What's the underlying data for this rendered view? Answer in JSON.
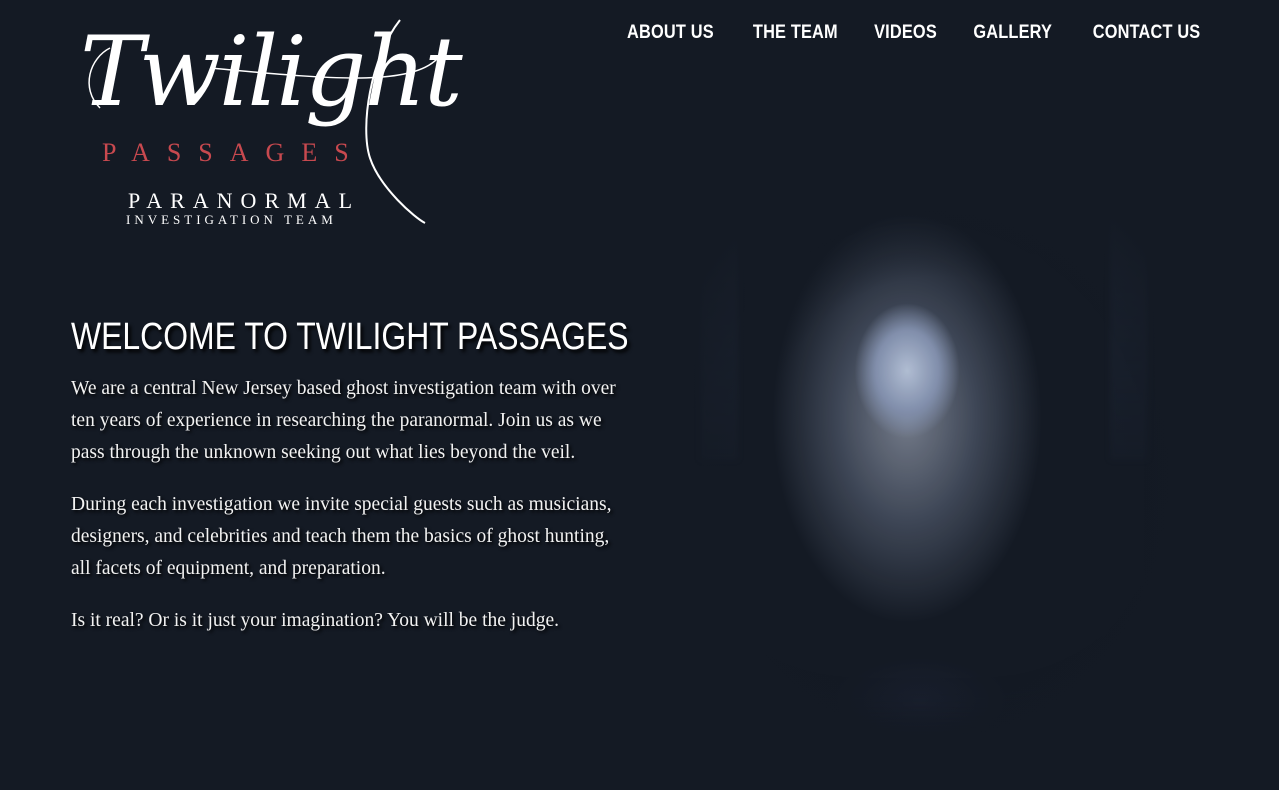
{
  "logo": {
    "title": "Twilight",
    "line2": "PASSAGES",
    "line3": "PARANORMAL",
    "line4": "INVESTIGATION TEAM"
  },
  "nav": {
    "items": [
      {
        "label": "ABOUT US"
      },
      {
        "label": "THE TEAM"
      },
      {
        "label": "VIDEOS"
      },
      {
        "label": "GALLERY"
      },
      {
        "label": "CONTACT US"
      }
    ]
  },
  "main": {
    "heading": "WELCOME TO TWILIGHT PASSAGES",
    "paragraphs": [
      "We are a central New Jersey based ghost investigation team with over ten years of experience in researching the paranormal. Join us as we pass through the unknown seeking out what lies beyond the veil.",
      "During each investigation we invite special guests such as musicians, designers, and celebrities and teach them the basics of ghost hunting, all facets of equipment, and preparation.",
      "Is it real? Or is it just your imagination? You will be the judge."
    ]
  },
  "colors": {
    "background": "#141a24",
    "accent_red": "#c8494f",
    "text": "#ffffff"
  }
}
